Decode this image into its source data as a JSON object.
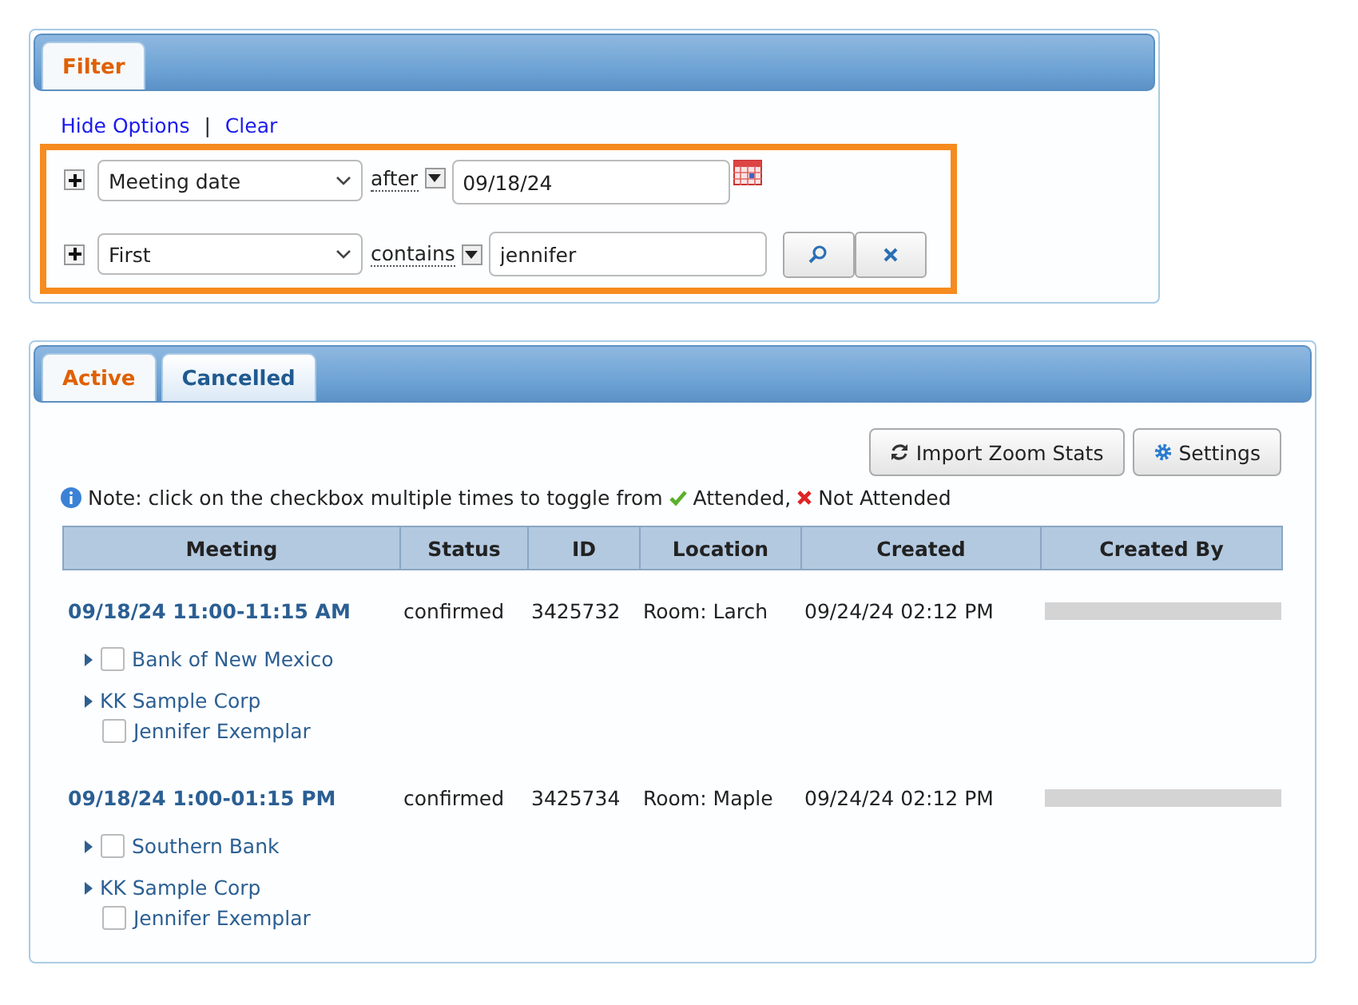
{
  "filter_panel": {
    "tabs": [
      {
        "label": "Filter",
        "selected": true
      }
    ],
    "links": [
      "Hide Options",
      "Clear"
    ],
    "separator": "|",
    "conditions": [
      {
        "kind": "date",
        "field": "Meeting date",
        "operator": "after",
        "value": "09/18/24"
      },
      {
        "kind": "text",
        "field": "First",
        "operator": "contains",
        "value": "jennifer"
      }
    ]
  },
  "results_panel": {
    "tabs": [
      {
        "label": "Active",
        "selected": true
      },
      {
        "label": "Cancelled",
        "selected": false
      }
    ],
    "buttons": [
      {
        "kind": "refresh",
        "label": "Import Zoom Stats"
      },
      {
        "kind": "gear",
        "label": "Settings"
      }
    ],
    "note": {
      "text": "Note: click on the checkbox multiple times to toggle from",
      "legend": [
        {
          "kind": "attended",
          "label": "Attended,"
        },
        {
          "kind": "not_attended",
          "label": "Not Attended"
        }
      ]
    },
    "table": {
      "columns": [
        "Meeting",
        "Status",
        "ID",
        "Location",
        "Created",
        "Created By"
      ],
      "rows": [
        {
          "meeting": "09/18/24 11:00-11:15 AM",
          "status": "confirmed",
          "id": "3425732",
          "location": "Room: Larch",
          "created": "09/24/24 02:12 PM",
          "children": [
            {
              "kind": "org",
              "name": "Bank of New Mexico",
              "checked": false
            },
            {
              "kind": "group",
              "name": "KK Sample Corp",
              "children": [
                {
                  "name": "Jennifer Exemplar",
                  "checked": false
                }
              ]
            }
          ]
        },
        {
          "meeting": "09/18/24 1:00-01:15 PM",
          "status": "confirmed",
          "id": "3425734",
          "location": "Room: Maple",
          "created": "09/24/24 02:12 PM",
          "children": [
            {
              "kind": "org",
              "name": "Southern Bank",
              "checked": false
            },
            {
              "kind": "group",
              "name": "KK Sample Corp",
              "children": [
                {
                  "name": "Jennifer Exemplar",
                  "checked": false
                }
              ]
            }
          ]
        }
      ]
    }
  }
}
